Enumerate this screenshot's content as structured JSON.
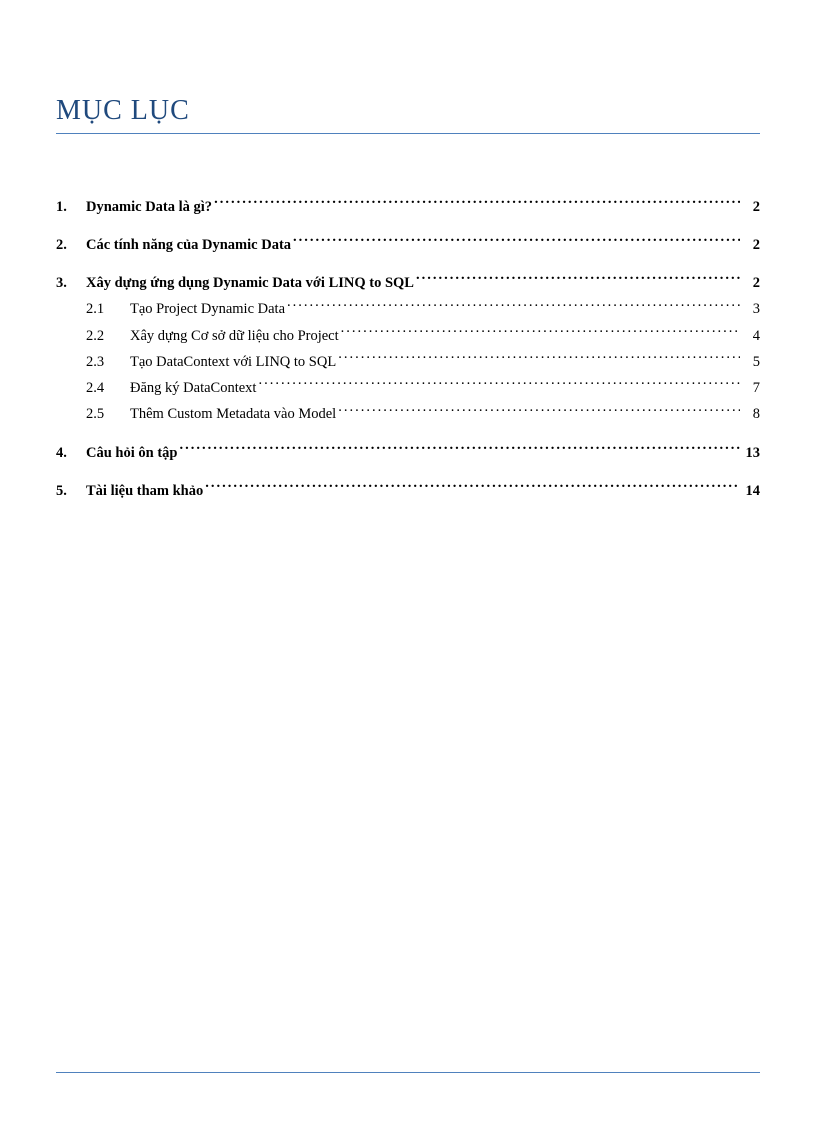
{
  "title": "MỤC LỤC",
  "toc": {
    "item1": {
      "num": "1.",
      "text": "Dynamic Data là gì? ",
      "page": "2"
    },
    "item2": {
      "num": "2.",
      "text": "Các tính năng của Dynamic Data",
      "page": "2"
    },
    "item3": {
      "num": "3.",
      "text": "Xây dựng ứng dụng Dynamic Data với LINQ to SQL ",
      "page": "2"
    },
    "item3_1": {
      "num": "2.1",
      "text": "Tạo Project Dynamic Data",
      "page": "3"
    },
    "item3_2": {
      "num": "2.2",
      "text": "Xây dựng Cơ sở dữ liệu cho Project",
      "page": "4"
    },
    "item3_3": {
      "num": "2.3",
      "text": "Tạo DataContext với LINQ to SQL",
      "page": "5"
    },
    "item3_4": {
      "num": "2.4",
      "text": "Đăng ký DataContext",
      "page": "7"
    },
    "item3_5": {
      "num": "2.5",
      "text": "Thêm Custom Metadata vào Model",
      "page": "8"
    },
    "item4": {
      "num": "4.",
      "text": "Câu hỏi ôn tập",
      "page": "13"
    },
    "item5": {
      "num": "5.",
      "text": "Tài liệu tham khảo ",
      "page": "14"
    }
  }
}
